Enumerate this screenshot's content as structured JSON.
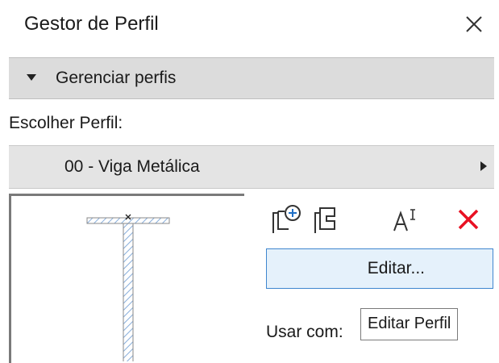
{
  "dialog": {
    "title": "Gestor de Perfil"
  },
  "section": {
    "label": "Gerenciar perfis"
  },
  "choose_label": "Escolher Perfil:",
  "profile": {
    "selected": "00 - Viga Metálica"
  },
  "edit_button": {
    "label": "Editar..."
  },
  "use_with_label": "Usar com:",
  "tooltip": {
    "text": "Editar Perfil"
  },
  "colors": {
    "accent_blue": "#3f86cf",
    "delete_red": "#e81123",
    "section_bg": "#dcdcdc"
  },
  "icons": [
    "close-icon",
    "collapse-triangle-icon",
    "expand-arrow-icon",
    "new-profile-icon",
    "duplicate-profile-icon",
    "rename-profile-icon",
    "delete-profile-icon"
  ]
}
